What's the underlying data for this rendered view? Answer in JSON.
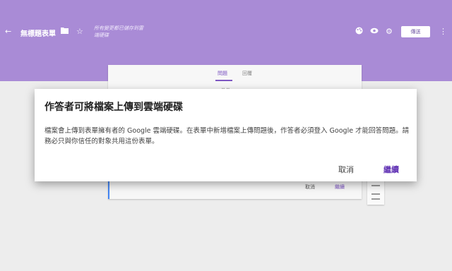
{
  "topbar": {
    "form_title": "無標題表單",
    "save_status_line1": "所有變更都已儲存到雲",
    "save_status_line2": "端硬碟",
    "send_label": "傳送",
    "color": "#a98bd6"
  },
  "form": {
    "tabs": [
      "問題",
      "回覆"
    ],
    "cancel_label": "取消",
    "continue_label": "繼續"
  },
  "dialog": {
    "title": "作答者可將檔案上傳到雲端硬碟",
    "body": "檔案會上傳到表單擁有者的 Google 雲端硬碟。在表單中新增檔案上傳問題後，作答者必須登入 Google 才能回答問題。請務必只與你信任的對象共用這份表單。",
    "cancel_label": "取消",
    "continue_label": "繼續",
    "accent": "#673ab7"
  }
}
